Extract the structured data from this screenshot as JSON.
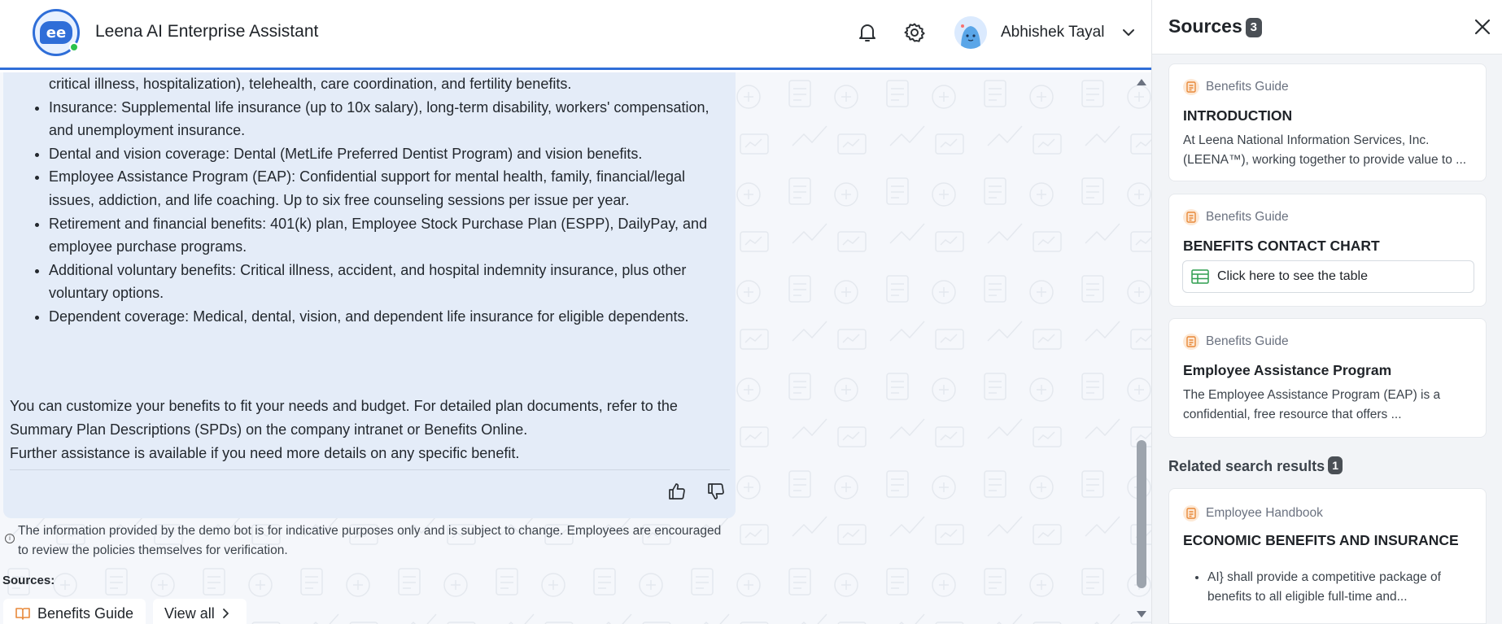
{
  "header": {
    "app_title": "Leena AI Enterprise Assistant",
    "user_name": "Abhishek Tayal"
  },
  "message": {
    "bullets": [
      "critical illness, hospitalization), telehealth, care coordination, and fertility benefits.",
      "Insurance: Supplemental life insurance (up to 10x salary), long-term disability, workers' compensation, and unemployment insurance.",
      "Dental and vision coverage: Dental (MetLife Preferred Dentist Program) and vision benefits.",
      "Employee Assistance Program (EAP): Confidential support for mental health, family, financial/legal issues, addiction, and life coaching. Up to six free counseling sessions per issue per year.",
      "Retirement and financial benefits: 401(k) plan, Employee Stock Purchase Plan (ESPP), DailyPay, and employee purchase programs.",
      "Additional voluntary benefits: Critical illness, accident, and hospital indemnity insurance, plus other voluntary options.",
      "Dependent coverage: Medical, dental, vision, and dependent life insurance for eligible dependents."
    ],
    "paragraph_1": "You can customize your benefits to fit your needs and budget. For detailed plan documents, refer to the Summary Plan Descriptions (SPDs) on the company intranet or Benefits Online.",
    "paragraph_2": "Further assistance is available if you need more details on any specific benefit."
  },
  "disclaimer": "The information provided by the demo bot is for indicative purposes only and is subject to change. Employees are encouraged to review the policies themselves for verification.",
  "sources_section": {
    "label": "Sources:",
    "chip": "Benefits Guide",
    "view_all": "View all"
  },
  "panel": {
    "title": "Sources",
    "count": "3",
    "cards": [
      {
        "kind": "Benefits Guide",
        "title": "INTRODUCTION",
        "desc": "At Leena National Information Services, Inc. (LEENA™), working together to provide value to ..."
      },
      {
        "kind": "Benefits Guide",
        "title": "BENEFITS CONTACT CHART",
        "button": "Click here to see the table"
      },
      {
        "kind": "Benefits Guide",
        "title": "Employee Assistance Program",
        "desc": "The Employee Assistance Program (EAP) is a confidential, free resource that offers ..."
      }
    ],
    "related_label": "Related search results",
    "related_count": "1",
    "related_card": {
      "kind": "Employee Handbook",
      "title": "ECONOMIC BENEFITS AND INSURANCE",
      "bullet": "AI} shall provide a competitive package of benefits to all eligible full-time and..."
    }
  },
  "colors": {
    "accent": "#2f6ed8",
    "bubble": "#e4ecf8",
    "panel_bg": "#f2f4f7",
    "doc_icon": "#e8893a"
  }
}
